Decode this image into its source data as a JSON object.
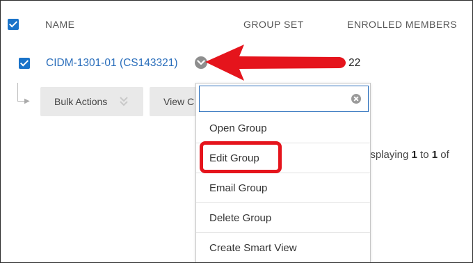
{
  "header": {
    "columns": [
      "NAME",
      "GROUP SET",
      "ENROLLED MEMBERS"
    ]
  },
  "row": {
    "name": "CIDM-1301-01 (CS143321)",
    "enrolled": "22"
  },
  "toolbar": {
    "bulk_actions_label": "Bulk Actions",
    "view_label": "View C"
  },
  "pagination": {
    "prefix": "isplaying ",
    "start": "1",
    "mid": " to ",
    "end": "1",
    "suffix": " of"
  },
  "dropdown": {
    "search_value": "",
    "items": [
      "Open Group",
      "Edit Group",
      "Email Group",
      "Delete Group",
      "Create Smart View"
    ]
  },
  "colors": {
    "accent": "#1a73c9",
    "link": "#2a6ebb",
    "annotation_red": "#e5141c"
  }
}
